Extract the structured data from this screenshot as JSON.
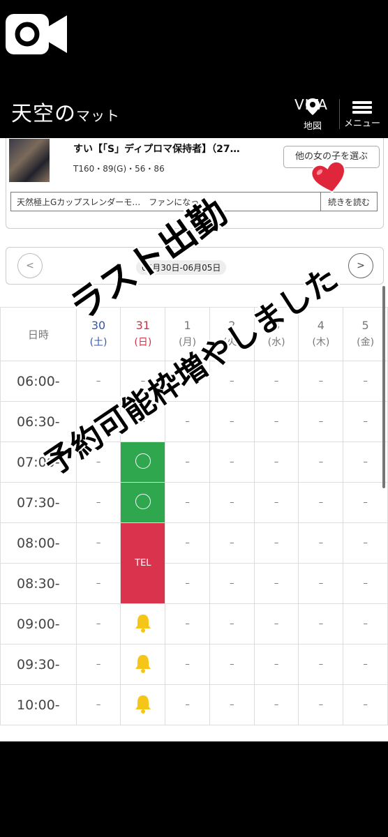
{
  "header": {
    "logo_main": "天空の",
    "logo_sub": "マット",
    "vita_label": "VITA",
    "map_label": "地図",
    "menu_label": "メニュー"
  },
  "profile": {
    "name": "すい【「S」ディプロマ保持者】（27…",
    "stats": "T160・89(G)・56・86",
    "choose_button": "他の女の子を選ぶ",
    "catchcopy": "天然極上Gカップスレンダーモ…　ファンになって…",
    "read_more": "続きを読む"
  },
  "week_nav": {
    "prev": "<",
    "next": ">",
    "range": "05月30日-06月05日"
  },
  "schedule": {
    "corner_label": "日時",
    "days": [
      {
        "date": "30",
        "weekday": "(土)",
        "type": "sat"
      },
      {
        "date": "31",
        "weekday": "(日)",
        "type": "sun"
      },
      {
        "date": "1",
        "weekday": "(月)",
        "type": "normal"
      },
      {
        "date": "2",
        "weekday": "(火)",
        "type": "normal"
      },
      {
        "date": "3",
        "weekday": "(水)",
        "type": "normal"
      },
      {
        "date": "4",
        "weekday": "(木)",
        "type": "normal"
      },
      {
        "date": "5",
        "weekday": "(金)",
        "type": "normal"
      }
    ],
    "rows": [
      {
        "time": "06:00-",
        "cells": [
          "–",
          "–",
          "–",
          "–",
          "–",
          "–",
          "–"
        ]
      },
      {
        "time": "06:30-",
        "cells": [
          "–",
          "–",
          "–",
          "–",
          "–",
          "–",
          "–"
        ]
      },
      {
        "time": "07:00-",
        "cells": [
          "–",
          "○",
          "–",
          "–",
          "–",
          "–",
          "–"
        ]
      },
      {
        "time": "07:30-",
        "cells": [
          "–",
          "○",
          "–",
          "–",
          "–",
          "–",
          "–"
        ]
      },
      {
        "time": "08:00-",
        "cells": [
          "–",
          "TEL",
          "–",
          "–",
          "–",
          "–",
          "–"
        ]
      },
      {
        "time": "08:30-",
        "cells": [
          "–",
          "TEL",
          "–",
          "–",
          "–",
          "–",
          "–"
        ]
      },
      {
        "time": "09:00-",
        "cells": [
          "–",
          "bell",
          "–",
          "–",
          "–",
          "–",
          "–"
        ]
      },
      {
        "time": "09:30-",
        "cells": [
          "–",
          "bell",
          "–",
          "–",
          "–",
          "–",
          "–"
        ]
      },
      {
        "time": "10:00-",
        "cells": [
          "–",
          "bell",
          "–",
          "–",
          "–",
          "–",
          "–"
        ]
      }
    ]
  },
  "overlay": {
    "line1": "ラスト出勤",
    "line2": "予約可能枠増やしました"
  },
  "colors": {
    "available": "#2ea74f",
    "tel": "#d9334e",
    "bell": "#f5c518",
    "saturday": "#3355aa",
    "sunday": "#cc3344"
  }
}
